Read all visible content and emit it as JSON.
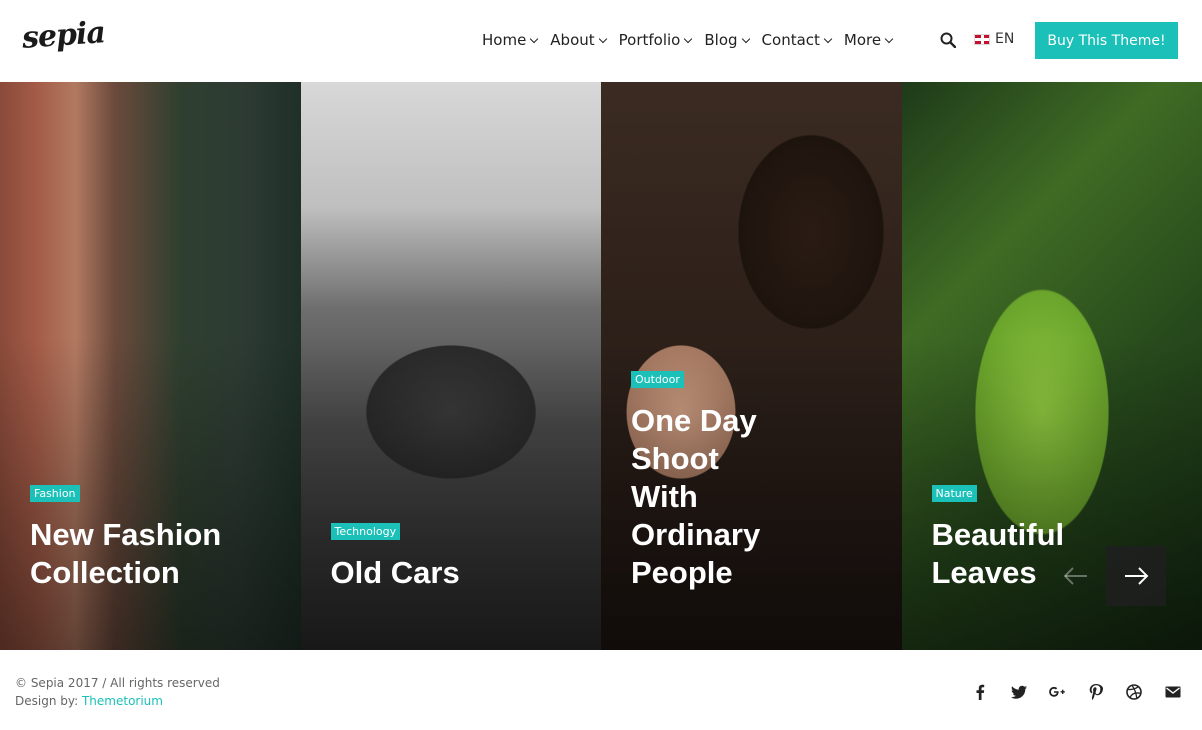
{
  "brand": {
    "logo": "sepia"
  },
  "nav": {
    "items": [
      {
        "label": "Home"
      },
      {
        "label": "About"
      },
      {
        "label": "Portfolio"
      },
      {
        "label": "Blog"
      },
      {
        "label": "Contact"
      },
      {
        "label": "More"
      }
    ],
    "search_icon": "search-icon",
    "language": "EN",
    "buy_button": "Buy This Theme!"
  },
  "slides": [
    {
      "tag": "Fashion",
      "title_lines": [
        "New Fashion",
        "Collection"
      ]
    },
    {
      "tag": "Technology",
      "title_lines": [
        "Old Cars"
      ]
    },
    {
      "tag": "Outdoor",
      "title_lines": [
        "One Day",
        "Shoot",
        "With",
        "Ordinary",
        "People"
      ]
    },
    {
      "tag": "Nature",
      "title_lines": [
        "Beautiful",
        "Leaves"
      ]
    }
  ],
  "footer": {
    "copyright": "© Sepia 2017 / All rights reserved",
    "design_by_label": "Design by:",
    "design_by_link": "Themetorium",
    "social": [
      "facebook-icon",
      "twitter-icon",
      "google-plus-icon",
      "pinterest-icon",
      "dribbble-icon",
      "email-icon"
    ]
  },
  "colors": {
    "accent": "#1bc0b8"
  }
}
